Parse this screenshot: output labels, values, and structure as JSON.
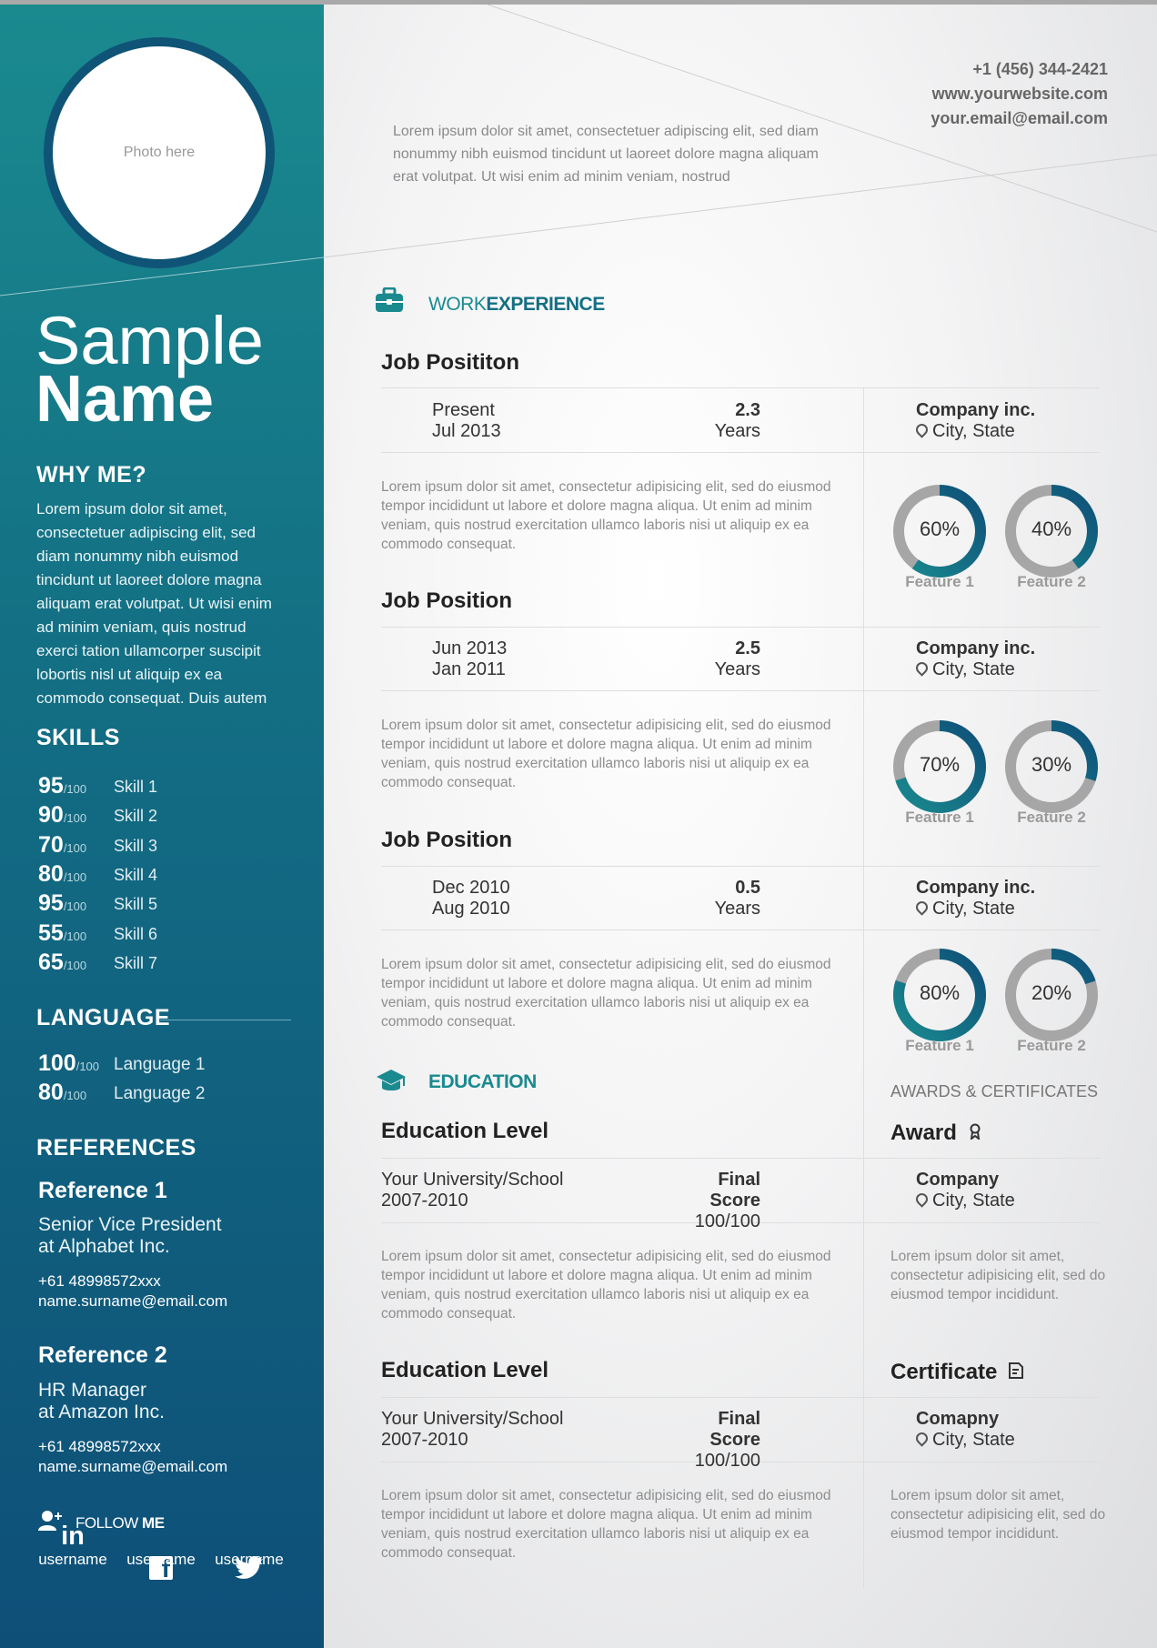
{
  "colors": {
    "accent": "#1a8a8f",
    "accent_dark": "#0e4f78",
    "donut_gray": "#a6a6a6"
  },
  "sidebar": {
    "photo_placeholder": "Photo here",
    "name_first": "Sample",
    "name_last": "Name",
    "why_me": {
      "heading": "WHY ME?",
      "text": "Lorem ipsum dolor sit amet, consectetuer adipiscing elit, sed diam nonummy nibh euismod tincidunt ut laoreet dolore magna aliquam erat volutpat. Ut wisi enim ad minim veniam, quis nostrud exerci tation ullamcorper suscipit lobortis nisl ut aliquip ex ea commodo consequat. Duis autem"
    },
    "skills": {
      "heading": "SKILLS",
      "max_label": "/100",
      "items": [
        {
          "value": "95",
          "name": "Skill 1"
        },
        {
          "value": "90",
          "name": "Skill 2"
        },
        {
          "value": "70",
          "name": "Skill 3"
        },
        {
          "value": "80",
          "name": "Skill 4"
        },
        {
          "value": "95",
          "name": "Skill 5"
        },
        {
          "value": "55",
          "name": "Skill 6"
        },
        {
          "value": "65",
          "name": "Skill 7"
        }
      ]
    },
    "language": {
      "heading": "LANGUAGE",
      "items": [
        {
          "value": "100",
          "name": "Language 1"
        },
        {
          "value": "80",
          "name": "Language 2"
        }
      ]
    },
    "references": {
      "heading": "REFERENCES",
      "items": [
        {
          "title": "Reference 1",
          "role_line1": "Senior Vice President",
          "role_line2": "at Alphabet Inc.",
          "phone": "+61 48998572xxx",
          "email": "name.surname@email.com"
        },
        {
          "title": "Reference 2",
          "role_line1": "HR Manager",
          "role_line2": "at Amazon Inc.",
          "phone": "+61 48998572xxx",
          "email": "name.surname@email.com"
        }
      ]
    },
    "follow": {
      "label_light": "FOLLOW",
      "label_bold": "ME"
    },
    "social": [
      {
        "icon": "linkedin-icon",
        "glyph": "in",
        "username": "username"
      },
      {
        "icon": "facebook-icon",
        "glyph": "f",
        "username": "username"
      },
      {
        "icon": "twitter-icon",
        "glyph": "",
        "username": "username"
      }
    ]
  },
  "header": {
    "phone": "+1 (456) 344-2421",
    "website": "www.yourwebsite.com",
    "email": "your.email@email.com",
    "intro": "Lorem ipsum dolor sit amet, consectetuer adipiscing elit, sed diam nonummy nibh euismod tincidunt ut laoreet dolore magna aliquam erat volutpat. Ut wisi enim ad minim veniam, nostrud"
  },
  "work": {
    "heading_light": "WORK",
    "heading_bold": "EXPERIENCE",
    "jobs": [
      {
        "title": "Job Posititon",
        "date_end": "Present",
        "date_start": "Jul 2013",
        "years_value": "2.3",
        "years_label": "Years",
        "company": "Company inc.",
        "location": "City, State",
        "desc": "Lorem ipsum dolor sit amet, consectetur adipisicing elit, sed do eiusmod tempor incididunt ut labore et dolore magna aliqua. Ut enim ad minim veniam, quis nostrud exercitation ullamco laboris nisi ut aliquip ex ea commodo consequat.",
        "features": [
          {
            "name": "Feature 1",
            "pct": 60,
            "label": "60%"
          },
          {
            "name": "Feature 2",
            "pct": 40,
            "label": "40%"
          }
        ]
      },
      {
        "title": "Job Position",
        "date_end": "Jun 2013",
        "date_start": "Jan 2011",
        "years_value": "2.5",
        "years_label": "Years",
        "company": "Company inc.",
        "location": "City, State",
        "desc": "Lorem ipsum dolor sit amet, consectetur adipisicing elit, sed do eiusmod tempor incididunt ut labore et dolore magna aliqua. Ut enim ad minim veniam, quis nostrud exercitation ullamco laboris nisi ut aliquip ex ea commodo consequat.",
        "features": [
          {
            "name": "Feature 1",
            "pct": 70,
            "label": "70%"
          },
          {
            "name": "Feature 2",
            "pct": 30,
            "label": "30%"
          }
        ]
      },
      {
        "title": "Job Position",
        "date_end": "Dec 2010",
        "date_start": "Aug 2010",
        "years_value": "0.5",
        "years_label": "Years",
        "company": "Company inc.",
        "location": "City, State",
        "desc": "Lorem ipsum dolor sit amet, consectetur adipisicing elit, sed do eiusmod tempor incididunt ut labore et dolore magna aliqua. Ut enim ad minim veniam, quis nostrud exercitation ullamco laboris nisi ut aliquip ex ea commodo consequat.",
        "features": [
          {
            "name": "Feature 1",
            "pct": 80,
            "label": "80%"
          },
          {
            "name": "Feature 2",
            "pct": 20,
            "label": "20%"
          }
        ]
      }
    ]
  },
  "education": {
    "heading": "EDUCATION",
    "items": [
      {
        "level": "Education Level",
        "school": "Your University/School",
        "years": "2007-2010",
        "score_label": "Final Score",
        "score": "100/100",
        "desc": "Lorem ipsum dolor sit amet, consectetur adipisicing elit, sed do eiusmod tempor incididunt ut labore et dolore magna aliqua. Ut enim ad minim veniam, quis nostrud exercitation ullamco laboris nisi ut aliquip ex ea commodo consequat."
      },
      {
        "level": "Education Level",
        "school": "Your University/School",
        "years": "2007-2010",
        "score_label": "Final Score",
        "score": "100/100",
        "desc": "Lorem ipsum dolor sit amet, consectetur adipisicing elit, sed do eiusmod tempor incididunt ut labore et dolore magna aliqua. Ut enim ad minim veniam, quis nostrud exercitation ullamco laboris nisi ut aliquip ex ea commodo consequat."
      }
    ]
  },
  "awards": {
    "heading": "AWARDS & CERTIFICATES",
    "items": [
      {
        "title": "Award",
        "icon": "award-icon",
        "company": "Company",
        "location": "City, State",
        "desc": "Lorem ipsum dolor sit amet, consectetur adipisicing elit, sed do eiusmod tempor incididunt."
      },
      {
        "title": "Certificate",
        "icon": "certificate-icon",
        "company": "Comapny",
        "location": "City, State",
        "desc": "Lorem ipsum dolor sit amet, consectetur adipisicing elit, sed do eiusmod tempor incididunt."
      }
    ]
  }
}
